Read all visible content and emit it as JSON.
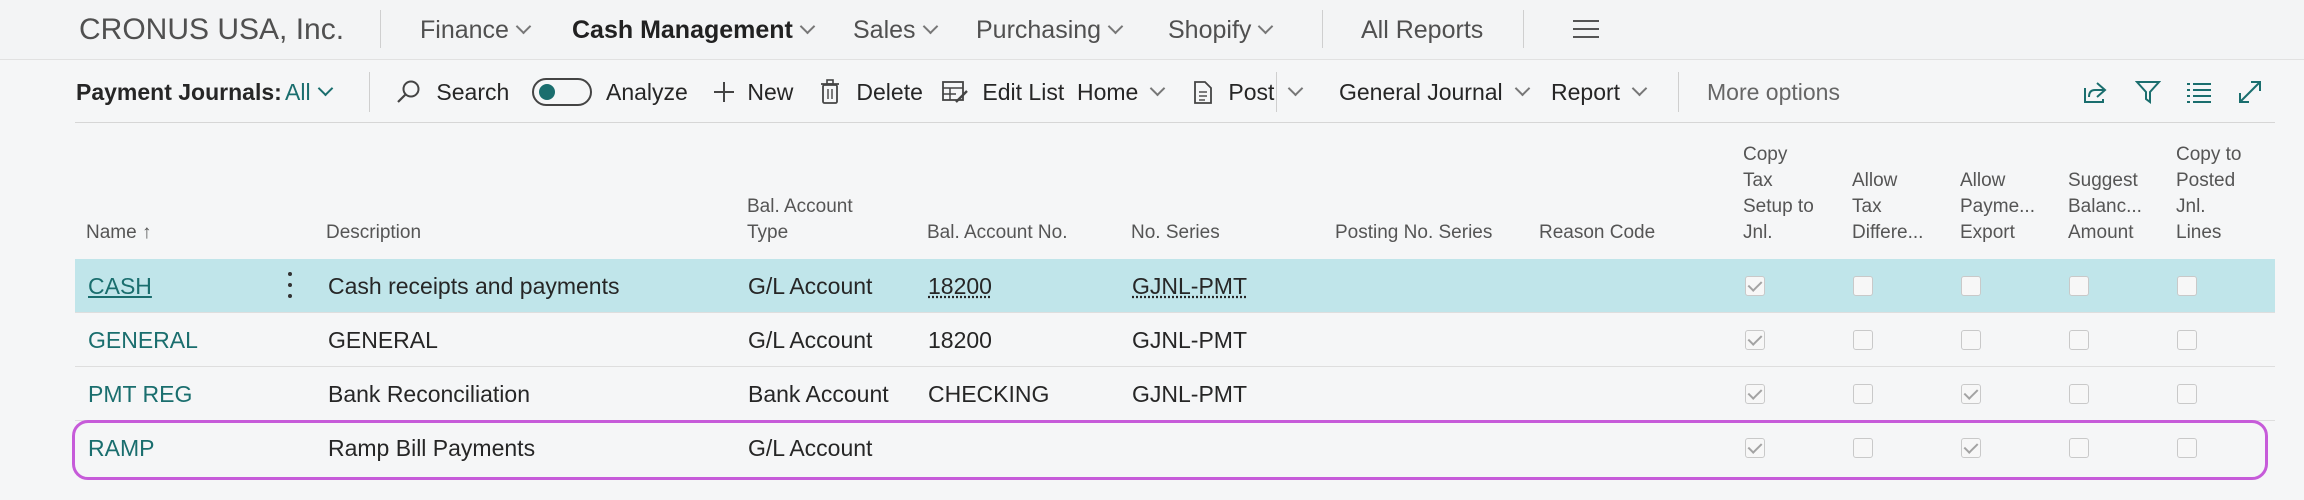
{
  "topnav": {
    "company": "CRONUS USA, Inc.",
    "items": [
      {
        "label": "Finance"
      },
      {
        "label": "Cash Management"
      },
      {
        "label": "Sales"
      },
      {
        "label": "Purchasing"
      },
      {
        "label": "Shopify"
      }
    ],
    "all_reports": "All Reports"
  },
  "actionbar": {
    "title": "Payment Journals:",
    "filter_value": "All",
    "search": "Search",
    "analyze": "Analyze",
    "analyze_on": false,
    "new": "New",
    "delete": "Delete",
    "edit_list": "Edit List",
    "home": "Home",
    "post": "Post",
    "general_journal": "General Journal",
    "report": "Report",
    "more_options": "More options"
  },
  "table": {
    "columns": {
      "name": "Name ↑",
      "description": "Description",
      "bal_type": [
        "Bal. Account",
        "Type"
      ],
      "bal_no": "Bal. Account No.",
      "no_series": "No. Series",
      "posting_no_series": "Posting No. Series",
      "reason_code": "Reason Code",
      "copy_tax": [
        "Copy",
        "Tax",
        "Setup to",
        "Jnl."
      ],
      "allow_tax": [
        "Allow",
        "Tax",
        "Differe..."
      ],
      "allow_pay": [
        "Allow",
        "Payme...",
        "Export"
      ],
      "suggest": [
        "Suggest",
        "Balanc...",
        "Amount"
      ],
      "copy_posted": [
        "Copy to",
        "Posted",
        "Jnl.",
        "Lines"
      ]
    },
    "rows": [
      {
        "name": "CASH",
        "description": "Cash receipts and payments",
        "bal_type": "G/L Account",
        "bal_no": "18200",
        "no_series": "GJNL-PMT",
        "copy_tax": true,
        "allow_tax": false,
        "allow_pay": false,
        "suggest": false,
        "copy_posted": false
      },
      {
        "name": "GENERAL",
        "description": "GENERAL",
        "bal_type": "G/L Account",
        "bal_no": "18200",
        "no_series": "GJNL-PMT",
        "copy_tax": true,
        "allow_tax": false,
        "allow_pay": false,
        "suggest": false,
        "copy_posted": false
      },
      {
        "name": "PMT REG",
        "description": "Bank Reconciliation",
        "bal_type": "Bank Account",
        "bal_no": "CHECKING",
        "no_series": "GJNL-PMT",
        "copy_tax": true,
        "allow_tax": false,
        "allow_pay": true,
        "suggest": false,
        "copy_posted": false
      },
      {
        "name": "RAMP",
        "description": "Ramp Bill Payments",
        "bal_type": "G/L Account",
        "bal_no": "",
        "no_series": "",
        "copy_tax": true,
        "allow_tax": false,
        "allow_pay": true,
        "suggest": false,
        "copy_posted": false
      }
    ]
  },
  "colors": {
    "link": "#1a6e6e",
    "selected_row": "#c0e5ea",
    "highlight_border": "#c65bd9"
  }
}
